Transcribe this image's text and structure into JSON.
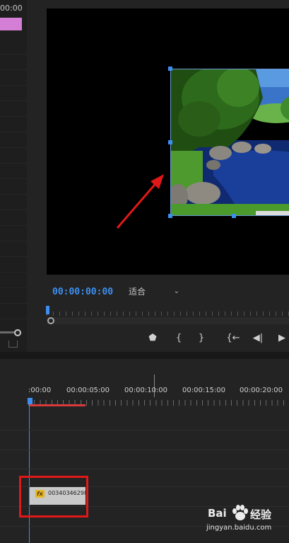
{
  "left_panel": {
    "timecode_fragment": "00:00"
  },
  "program_monitor": {
    "timecode": "00:00:00:00",
    "fit_select": {
      "value": "适合"
    },
    "clip_preview": {
      "description_icon": "landscape-image"
    },
    "transport": [
      {
        "icon": "add-marker-icon",
        "glyph": "⬟"
      },
      {
        "icon": "mark-in-icon",
        "glyph": "{"
      },
      {
        "icon": "mark-out-icon",
        "glyph": "}"
      },
      {
        "icon": "go-to-in-icon",
        "glyph": "{←"
      },
      {
        "icon": "step-back-icon",
        "glyph": "◀|"
      },
      {
        "icon": "play-icon",
        "glyph": "▶"
      }
    ]
  },
  "timeline": {
    "ruler_labels": [
      ":00:00",
      "00:00:05:00",
      "00:00:10:00",
      "00:00:15:00",
      "00:00:20:00"
    ],
    "clip": {
      "fx_label": "fx",
      "name": "00340346298"
    }
  },
  "watermark": {
    "brand_left": "Bai",
    "brand_right": "经验",
    "url": "jingyan.baidu.com"
  },
  "colors": {
    "accent": "#3c8ef0",
    "highlight_box": "#e01818",
    "workarea": "#d83a3a",
    "fx_badge": "#e3b626"
  }
}
